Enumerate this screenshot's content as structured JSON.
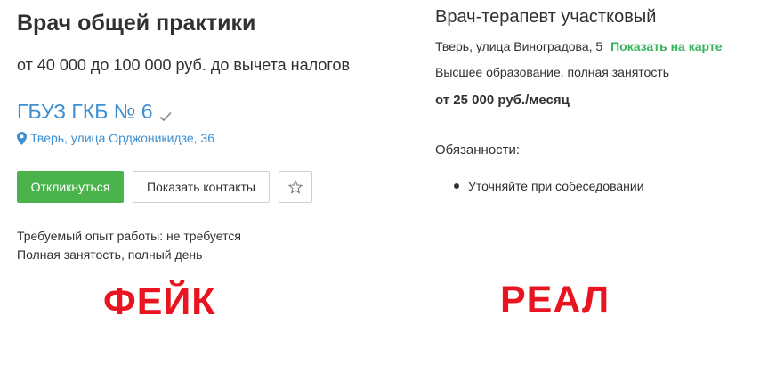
{
  "fake": {
    "title": "Врач общей практики",
    "salary": "от 40 000 до 100 000 руб. до вычета налогов",
    "company": "ГБУЗ ГКБ № 6",
    "address": "Тверь, улица Орджоникидзе, 36",
    "respond_label": "Откликнуться",
    "contacts_label": "Показать контакты",
    "experience": "Требуемый опыт работы: не требуется",
    "employment": "Полная занятость, полный день",
    "caption": "ФЕЙК"
  },
  "real": {
    "title": "Врач-терапевт участковый",
    "address": "Тверь, улица Виноградова, 5",
    "map_link": "Показать на карте",
    "education": "Высшее образование, полная занятость",
    "salary": "от 25 000 руб./месяц",
    "duties_heading": "Обязанности:",
    "duties": [
      "Уточняйте при собеседовании"
    ],
    "caption": "РЕАЛ"
  },
  "icons": {
    "verified": "check-icon",
    "location": "map-pin-icon",
    "favorite": "star-outline-icon"
  },
  "colors": {
    "accent_link": "#3d8fd1",
    "primary_button": "#4bb34b",
    "map_link": "#34b45a",
    "caption": "#e8141f"
  }
}
